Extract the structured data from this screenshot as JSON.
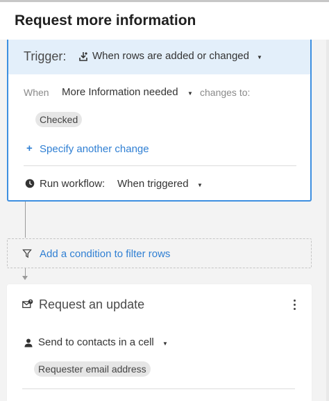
{
  "header": {
    "title": "Request more information"
  },
  "trigger": {
    "label": "Trigger:",
    "value": "When rows are added or changed",
    "when_label": "When",
    "when_field": "More Information needed",
    "changes_to": "changes to:",
    "changed_value": "Checked",
    "add_change": "Specify another change",
    "run_label": "Run workflow:",
    "run_value": "When triggered"
  },
  "filter": {
    "label": "Add a condition to filter rows"
  },
  "action": {
    "title": "Request an update",
    "send_label": "Send to contacts in a cell",
    "contact_field": "Requester email address"
  },
  "colors": {
    "accent": "#3d8fe0",
    "link": "#2f7fd3",
    "trigger_bg": "#e3effa"
  },
  "icons": [
    "trigger-icon",
    "chevron-down-icon",
    "plus-icon",
    "clock-icon",
    "filter-icon",
    "mail-icon",
    "more-icon",
    "person-icon"
  ]
}
